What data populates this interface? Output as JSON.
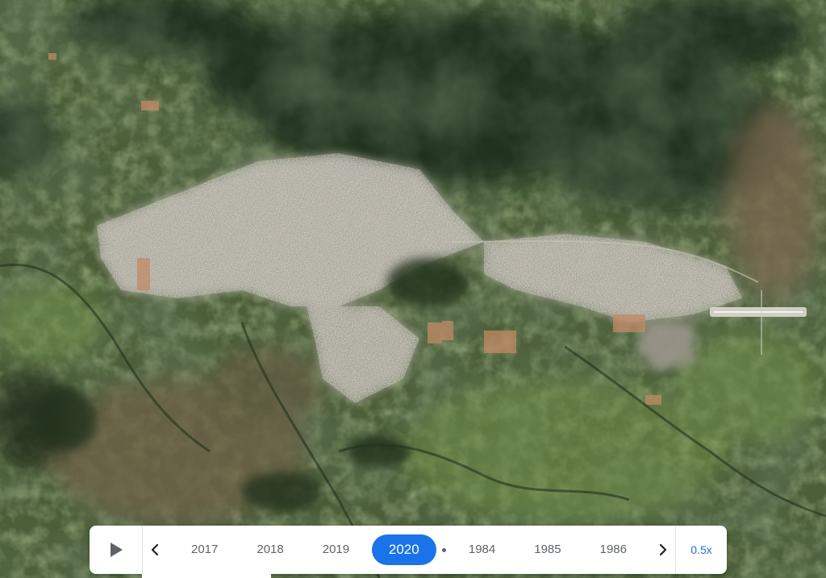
{
  "timeline": {
    "play_icon": "play-icon",
    "prev_icon": "chevron-left-icon",
    "next_icon": "chevron-right-icon",
    "years_before": [
      "2017",
      "2018",
      "2019"
    ],
    "selected_year": "2020",
    "years_after": [
      "1984",
      "1985",
      "1986"
    ],
    "speed_label": "0.5x"
  },
  "colors": {
    "accent": "#1a73e8",
    "year_text": "#5f6368",
    "panel": "#ffffff"
  }
}
